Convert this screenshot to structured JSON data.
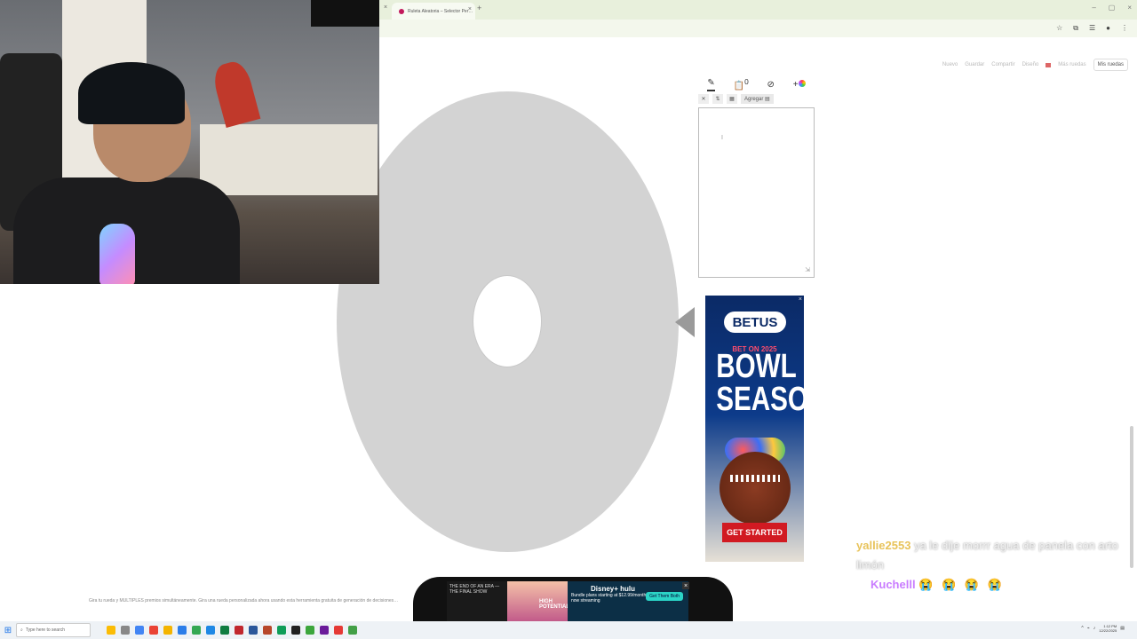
{
  "browser": {
    "tab_title": "Ruleta Aleatoria – Selector Per…",
    "new_tab_symbol": "+",
    "close_symbol": "×",
    "window_controls": [
      "–",
      "▢",
      "×"
    ]
  },
  "topnav": {
    "items": [
      "Nuevo",
      "Guardar",
      "Compartir",
      "Diseño"
    ],
    "more_label": "Más ruedas",
    "wheels_button": "Mis ruedas"
  },
  "editor": {
    "tools": [
      "pencil-icon",
      "clipboard-icon",
      "eye-off-icon",
      "palette-icon"
    ],
    "badge": "0",
    "add_label": "Agregar ▤",
    "cursor_char": "I",
    "resize_symbol": "⇲"
  },
  "ad_betus": {
    "brand": "BETUS",
    "tagline": "BET ON 2025",
    "headline_line1": "BOWL",
    "headline_line2": "SEASON",
    "cta": "GET STARTED",
    "close": "×"
  },
  "chat": {
    "messages": [
      {
        "user": "yallie2553",
        "text": "ya le dije morrr agua de panela con arto limón"
      },
      {
        "user": "Kuchelll",
        "text": "😭 😭 😭 😭"
      }
    ]
  },
  "bottom": {
    "description": "Gira tu rueda y MÚLTIPLES premios simultáneamente. Gira una rueda personalizada ahora usando esta herramienta gratuita de generación de decisiones…",
    "ad_text1": "THE END OF AN ERA — THE FINAL SHOW",
    "ad_text2": "HIGH POTENTIAL",
    "ad_brand": "Disney+ hulu",
    "ad_offer": "Bundle plans starting at $12.99/month. These and more now streaming",
    "ad_cta": "Get Them Both"
  },
  "taskbar": {
    "search_placeholder": "Type here to search",
    "time": "1:12 PM",
    "date": "12/22/2025"
  }
}
